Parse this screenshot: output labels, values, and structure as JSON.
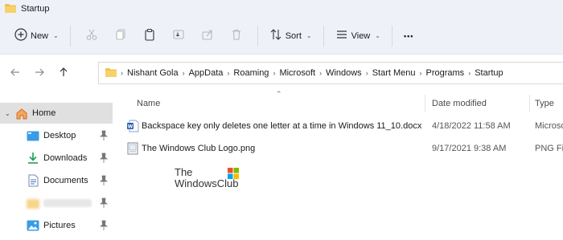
{
  "window": {
    "title": "Startup"
  },
  "commandbar": {
    "new_label": "New",
    "sort_label": "Sort",
    "view_label": "View",
    "more_label": "•••"
  },
  "address": {
    "crumbs": [
      "Nishant Gola",
      "AppData",
      "Roaming",
      "Microsoft",
      "Windows",
      "Start Menu",
      "Programs",
      "Startup"
    ]
  },
  "nav": {
    "items": [
      {
        "label": "Home",
        "icon": "home-icon",
        "selected": true
      },
      {
        "label": "Desktop",
        "icon": "desktop-folder-icon",
        "pinned": true
      },
      {
        "label": "Downloads",
        "icon": "downloads-icon",
        "pinned": true
      },
      {
        "label": "Documents",
        "icon": "documents-icon",
        "pinned": true
      },
      {
        "label": "",
        "icon": "folder-icon",
        "pinned": true,
        "blurred": true
      },
      {
        "label": "Pictures",
        "icon": "pictures-icon",
        "pinned": true
      }
    ]
  },
  "filelist": {
    "columns": {
      "name": "Name",
      "date": "Date modified",
      "type": "Type"
    },
    "rows": [
      {
        "name": "Backspace key only deletes one letter at a time in Windows 11_10.docx",
        "date": "4/18/2022 11:58 AM",
        "type": "Microso",
        "icon": "word-doc-icon"
      },
      {
        "name": "The Windows Club Logo.png",
        "date": "9/17/2021 9:38 AM",
        "type": "PNG Fil",
        "icon": "png-image-icon"
      }
    ]
  },
  "watermark": {
    "line1": "The",
    "line2": "WindowsClub"
  },
  "colors": {
    "accent": "#0067c0",
    "folder": "#f2c14b",
    "selected": "#e0e0e0",
    "toolbar_bg": "#eef1f8"
  }
}
